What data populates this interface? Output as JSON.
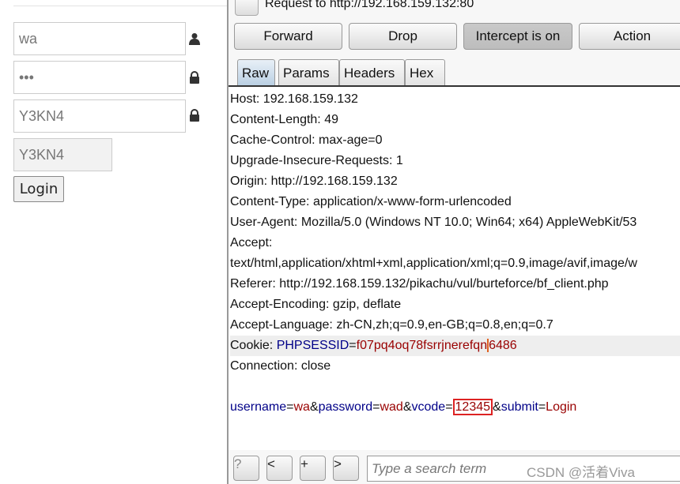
{
  "login_form": {
    "username": "wa",
    "password": "•••",
    "vcode_input": "Y3KN4",
    "captcha": "Y3KN4",
    "login_label": "Login"
  },
  "proxy": {
    "request_title": "Request to http://192.168.159.132:80",
    "buttons": [
      "Forward",
      "Drop",
      "Intercept is on",
      "Action"
    ],
    "tabs": [
      "Raw",
      "Params",
      "Headers",
      "Hex"
    ],
    "headers": [
      "Host: 192.168.159.132",
      "Content-Length: 49",
      "Cache-Control: max-age=0",
      "Upgrade-Insecure-Requests: 1",
      "Origin: http://192.168.159.132",
      "Content-Type: application/x-www-form-urlencoded",
      "User-Agent: Mozilla/5.0 (Windows NT 10.0; Win64; x64) AppleWebKit/53",
      "Accept:",
      "text/html,application/xhtml+xml,application/xml;q=0.9,image/avif,image/w",
      "Referer: http://192.168.159.132/pikachu/vul/burteforce/bf_client.php",
      "Accept-Encoding: gzip, deflate",
      "Accept-Language: zh-CN,zh;q=0.9,en-GB;q=0.8,en;q=0.7"
    ],
    "cookie": {
      "label": "Cookie: ",
      "name": "PHPSESSID",
      "eq": "=",
      "value_a": "f07pq4oq78fsrrjnerefqn",
      "value_b": "6486"
    },
    "connection": "Connection: close",
    "body": {
      "k1": "username",
      "v1": "wa",
      "k2": "password",
      "v2": "wad",
      "k3": "vcode",
      "v3": "12345",
      "k4": "submit",
      "v4": "Login",
      "amp": "&",
      "eq": "="
    },
    "search_buttons": [
      "?",
      "<",
      "+",
      ">"
    ],
    "search_placeholder": "Type a search term",
    "watermark": "CSDN @活着Viva"
  },
  "colors": {
    "param_name": "#000088",
    "param_value": "#990000",
    "highlight_box": "#dd2222"
  }
}
